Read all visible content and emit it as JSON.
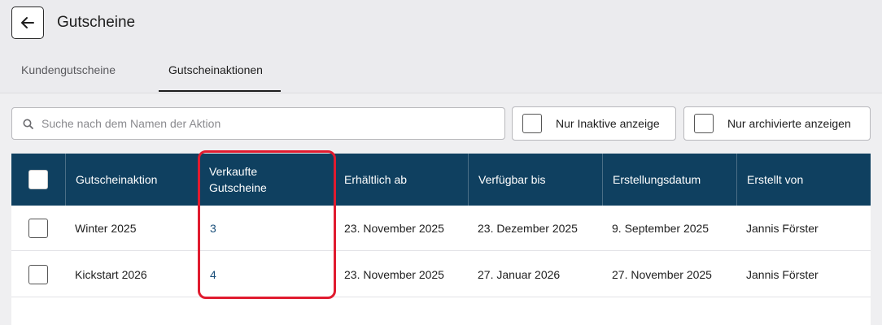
{
  "header": {
    "title": "Gutscheine",
    "back_icon": "arrow-left-icon"
  },
  "tabs": [
    {
      "label": "Kundengutscheine",
      "active": false
    },
    {
      "label": "Gutscheinaktionen",
      "active": true
    }
  ],
  "filters": {
    "search": {
      "placeholder": "Suche nach dem Namen der Aktion",
      "value": "",
      "icon": "search-icon"
    },
    "inactive_label": "Nur Inaktive anzeige",
    "inactive_checked": false,
    "archived_label": "Nur archivierte anzeigen",
    "archived_checked": false
  },
  "table": {
    "columns": [
      "Gutscheinaktion",
      "Verkaufte Gutscheine",
      "Erhältlich ab",
      "Verfügbar bis",
      "Erstellungsdatum",
      "Erstellt von"
    ],
    "rows": [
      {
        "name": "Winter 2025",
        "sold": "3",
        "available_from": "23. November 2025",
        "available_until": "23. Dezember 2025",
        "created": "9. September 2025",
        "created_by": "Jannis Förster"
      },
      {
        "name": "Kickstart 2026",
        "sold": "4",
        "available_from": "23. November 2025",
        "available_until": "27. Januar 2026",
        "created": "27. November 2025",
        "created_by": "Jannis Förster"
      }
    ]
  },
  "colors": {
    "header_bg": "#0f4060",
    "highlight": "#e01b2f",
    "link": "#1a4f7a"
  }
}
